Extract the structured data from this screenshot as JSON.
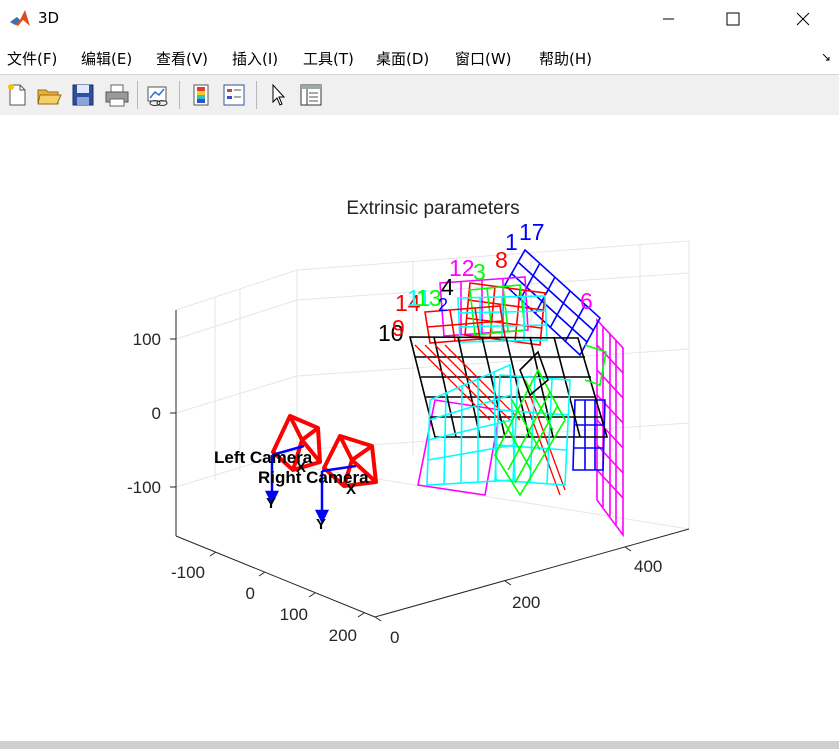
{
  "window": {
    "title": "3D"
  },
  "menu": [
    "文件(F)",
    "编辑(E)",
    "查看(V)",
    "插入(I)",
    "工具(T)",
    "桌面(D)",
    "窗口(W)",
    "帮助(H)"
  ],
  "menu_overflow": "↘",
  "toolbar": {
    "buttons": [
      "new-figure",
      "open-file",
      "save",
      "print",
      "link-plot",
      "insert-colorbar",
      "insert-legend",
      "edit-plot",
      "property-inspector"
    ]
  },
  "plot": {
    "title": "Extrinsic parameters",
    "z_ticks": [
      "100",
      "0",
      "-100"
    ],
    "x_ticks": [
      "-100",
      "0",
      "100",
      "200"
    ],
    "y_ticks": [
      "0",
      "200",
      "400"
    ],
    "camera_labels": {
      "left": "Left Camera",
      "right": "Right Camera"
    },
    "axis_letters": {
      "left_y": "Y",
      "right_y": "Y",
      "left_x": "X",
      "right_x": "X"
    },
    "board_labels": [
      "17",
      "1",
      "8",
      "12",
      "3",
      "6",
      "4",
      "14",
      "11",
      "13",
      "2",
      "10",
      "9"
    ],
    "colors": {
      "red": "#ff0000",
      "blue": "#0000ff",
      "green": "#00ff00",
      "cyan": "#00ffff",
      "magenta": "#ff00ff",
      "black": "#000000",
      "frame": "#ff0000",
      "axis": "#0000c8"
    }
  }
}
